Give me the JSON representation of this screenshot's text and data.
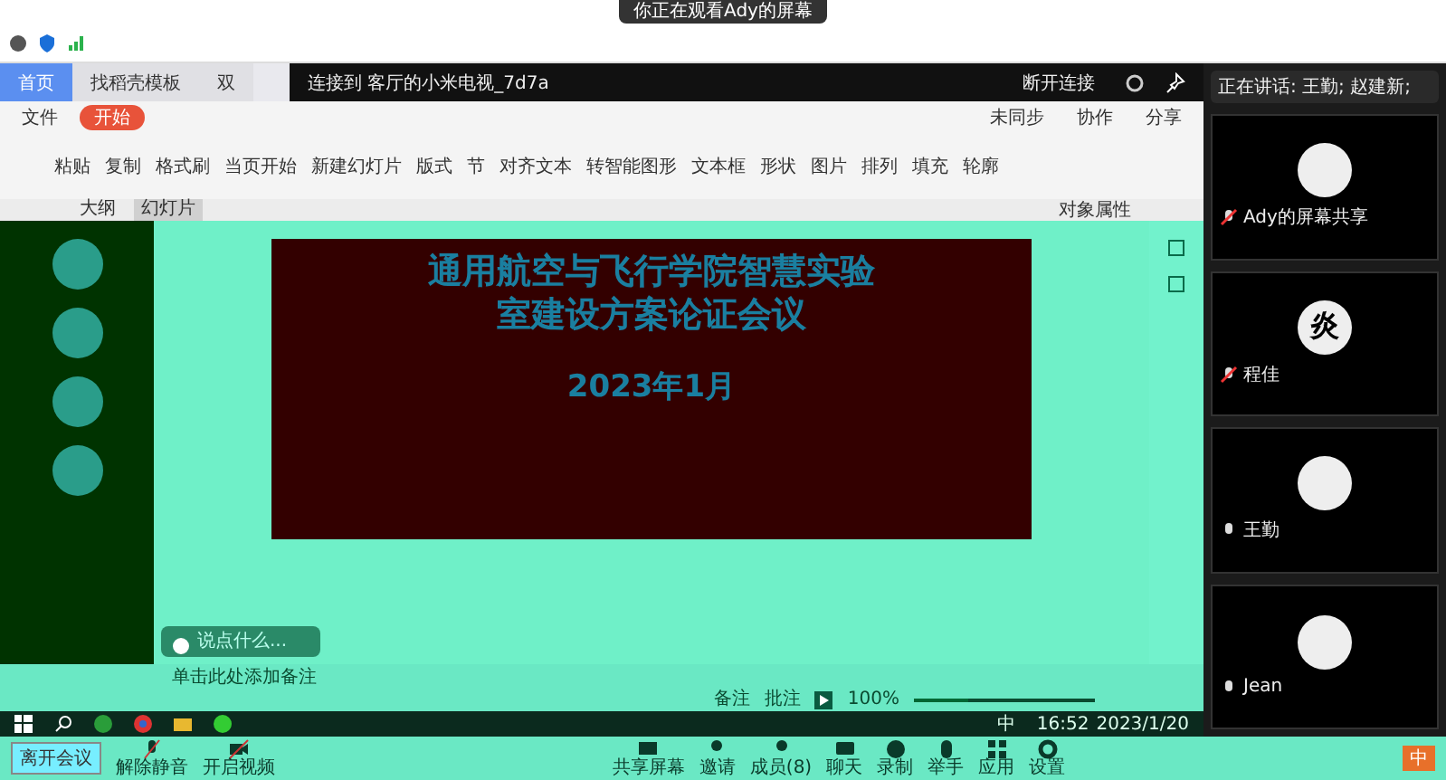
{
  "top_banner": {
    "text": "你正在观看Ady的屏幕"
  },
  "browser_tabs": [
    {
      "label": "首页",
      "selected": true
    },
    {
      "label": "找稻壳模板",
      "selected": false
    },
    {
      "label": "双",
      "selected": false
    }
  ],
  "cast_bar": {
    "text": "连接到 客厅的小米电视_7d7a",
    "disconnect": "断开连接"
  },
  "speaking_toast": {
    "text": "正在讲话: 王勤; 赵建新;"
  },
  "menu": {
    "file": "文件",
    "tabs": [
      {
        "label": "开始",
        "selected": true
      }
    ],
    "sync": "未同步",
    "collab": "协作",
    "share": "分享"
  },
  "ribbon": [
    {
      "label": "粘贴"
    },
    {
      "label": "复制"
    },
    {
      "label": "格式刷"
    },
    {
      "label": "当页开始"
    },
    {
      "label": "新建幻灯片"
    },
    {
      "label": "版式"
    },
    {
      "label": "节"
    },
    {
      "label": "对齐文本"
    },
    {
      "label": "转智能图形"
    },
    {
      "label": "文本框"
    },
    {
      "label": "形状"
    },
    {
      "label": "图片"
    },
    {
      "label": "排列"
    },
    {
      "label": "填充"
    },
    {
      "label": "轮廓"
    }
  ],
  "panel_tabs": [
    {
      "label": "大纲",
      "selected": false
    },
    {
      "label": "幻灯片",
      "selected": true
    }
  ],
  "object_panel": {
    "title": "对象属性"
  },
  "slide": {
    "title": "通用航空与飞行学院智慧实验室建设方案论证会议",
    "date": "2023年1月"
  },
  "chat_input": {
    "placeholder": "说点什么..."
  },
  "notes": {
    "placeholder": "单击此处添加备注"
  },
  "status_bar": {
    "notes": "备注",
    "comments": "批注",
    "zoom": "100%",
    "level": 0.3
  },
  "taskbar": {
    "ime": "中",
    "time": "16:52",
    "date": "2023/1/20"
  },
  "participants": [
    {
      "name": "Ady的屏幕共享",
      "muted": true
    },
    {
      "name": "程佳",
      "avatar_text": "炎",
      "muted": true
    },
    {
      "name": "王勤",
      "muted": false
    },
    {
      "name": "Jean",
      "muted": false
    }
  ],
  "meeting_toolbar": {
    "left": [
      {
        "kind": "mic",
        "label": "解除静音"
      },
      {
        "kind": "video",
        "label": "开启视频"
      }
    ],
    "center": [
      {
        "kind": "share",
        "label": "共享屏幕"
      },
      {
        "kind": "invite",
        "label": "邀请"
      },
      {
        "kind": "members",
        "label": "成员(8)"
      },
      {
        "kind": "chat",
        "label": "聊天"
      },
      {
        "kind": "record",
        "label": "录制"
      },
      {
        "kind": "hand",
        "label": "举手"
      },
      {
        "kind": "apps",
        "label": "应用"
      },
      {
        "kind": "settings",
        "label": "设置"
      }
    ],
    "leave": "离开会议"
  },
  "ime_bar": {
    "text": "中"
  }
}
